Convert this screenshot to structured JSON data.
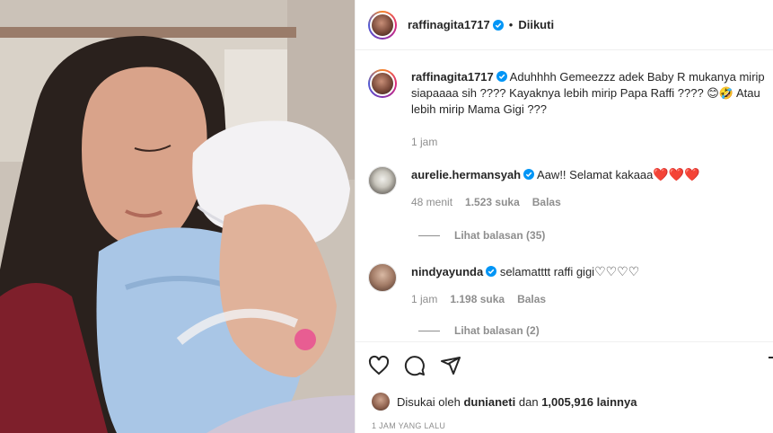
{
  "post": {
    "author": "raffinagita1717",
    "follow_status": "Diikuti",
    "separator": "•"
  },
  "caption": {
    "username": "raffinagita1717",
    "text": "Aduhhhh Gemeezzz adek Baby R mukanya mirip siapaaaa sih ???? Kayaknya lebih mirip Papa Raffi ???? 😊🤣 Atau lebih mirip Mama Gigi ???",
    "time": "1 jam"
  },
  "comments": [
    {
      "username": "aurelie.hermansyah",
      "text": "Aaw!! Selamat kakaaa",
      "hearts": "❤️❤️❤️",
      "time": "48 menit",
      "likes": "1.523 suka",
      "reply_label": "Balas",
      "view_replies": "Lihat balasan (35)"
    },
    {
      "username": "nindyayunda",
      "text": "selamatttt raffi gigi",
      "hearts": "♡♡♡♡",
      "time": "1 jam",
      "likes": "1.198 suka",
      "reply_label": "Balas",
      "view_replies": "Lihat balasan (2)"
    }
  ],
  "actions": {
    "icons": [
      "heart-icon",
      "comment-icon",
      "share-icon",
      "save-icon"
    ]
  },
  "likes": {
    "prefix": "Disukai oleh",
    "user": "dunianeti",
    "middle": "dan",
    "count": "1,005,916 lainnya"
  },
  "timestamp": "1 JAM YANG LALU",
  "colors": {
    "accent_blue": "#0095f6",
    "heart_red": "#ed4956",
    "muted": "#8e8e8e"
  }
}
